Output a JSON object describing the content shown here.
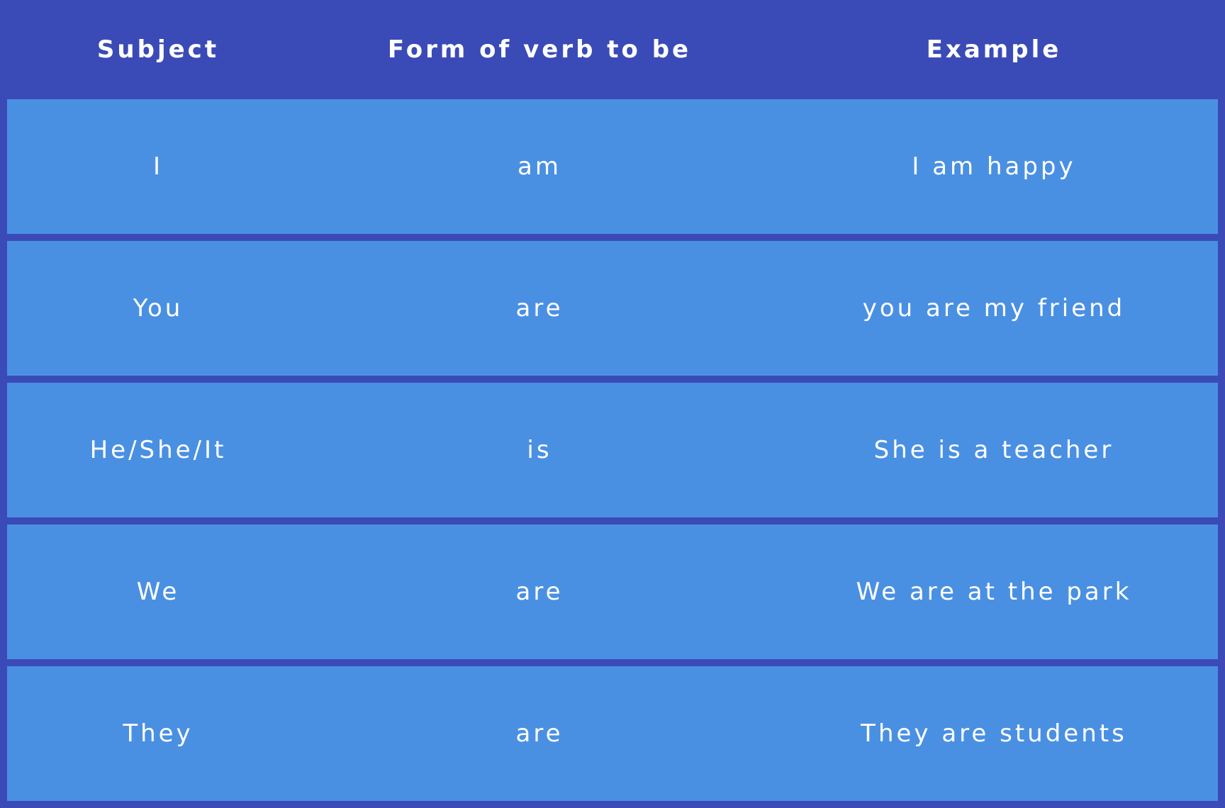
{
  "table": {
    "colors": {
      "header_bg": "#3a4bb7",
      "row_bg": "#4a90e2",
      "text": "#ffffff"
    },
    "headers": [
      "Subject",
      "Form of verb to be",
      "Example"
    ],
    "rows": [
      {
        "subject": "I",
        "verb": "am",
        "example": "I am happy"
      },
      {
        "subject": "You",
        "verb": "are",
        "example": "you are my friend"
      },
      {
        "subject": "He/She/It",
        "verb": "is",
        "example": "She is a teacher"
      },
      {
        "subject": "We",
        "verb": "are",
        "example": "We are at the park"
      },
      {
        "subject": "They",
        "verb": "are",
        "example": "They are students"
      }
    ]
  }
}
